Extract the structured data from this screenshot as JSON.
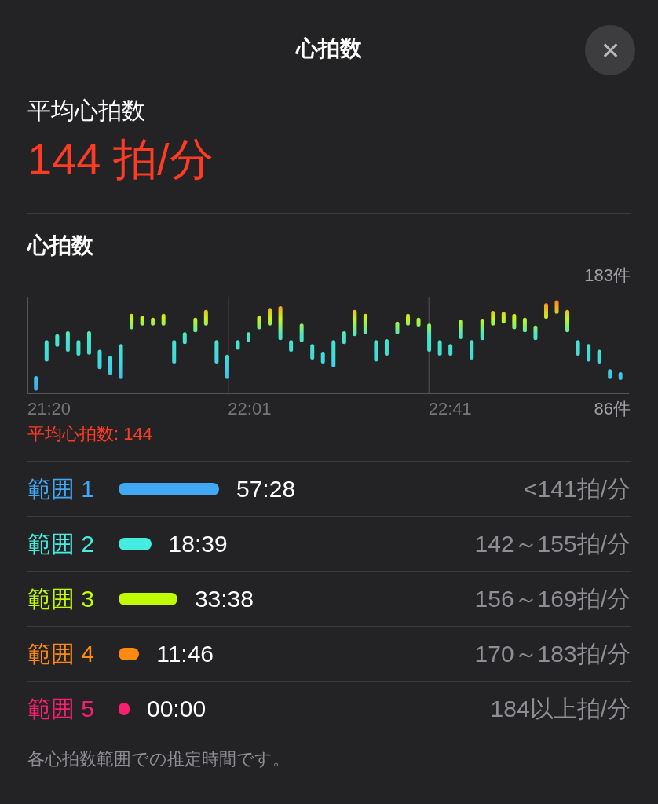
{
  "header": {
    "title": "心拍数",
    "close": "✕"
  },
  "average": {
    "label": "平均心拍数",
    "value": "144 拍/分"
  },
  "section_title": "心拍数",
  "chart": {
    "top_label": "183件",
    "bottom_label": "86件",
    "x_labels": [
      "21:20",
      "22:01",
      "22:41"
    ],
    "average_label": "平均心拍数: 144"
  },
  "zones": [
    {
      "label": "範囲 1",
      "color": "#40a8f5",
      "time": "57:28",
      "range": "<141拍/分"
    },
    {
      "label": "範囲 2",
      "color": "#45ece0",
      "time": "18:39",
      "range": "142～155拍/分"
    },
    {
      "label": "範囲 3",
      "color": "#c0fb00",
      "time": "33:38",
      "range": "156～169拍/分"
    },
    {
      "label": "範囲 4",
      "color": "#ff8a10",
      "time": "11:46",
      "range": "170～183拍/分"
    },
    {
      "label": "範囲 5",
      "color": "#fa1f70",
      "time": "00:00",
      "range": "184以上拍/分"
    }
  ],
  "footnote": "各心拍数範囲での推定時間です。"
}
